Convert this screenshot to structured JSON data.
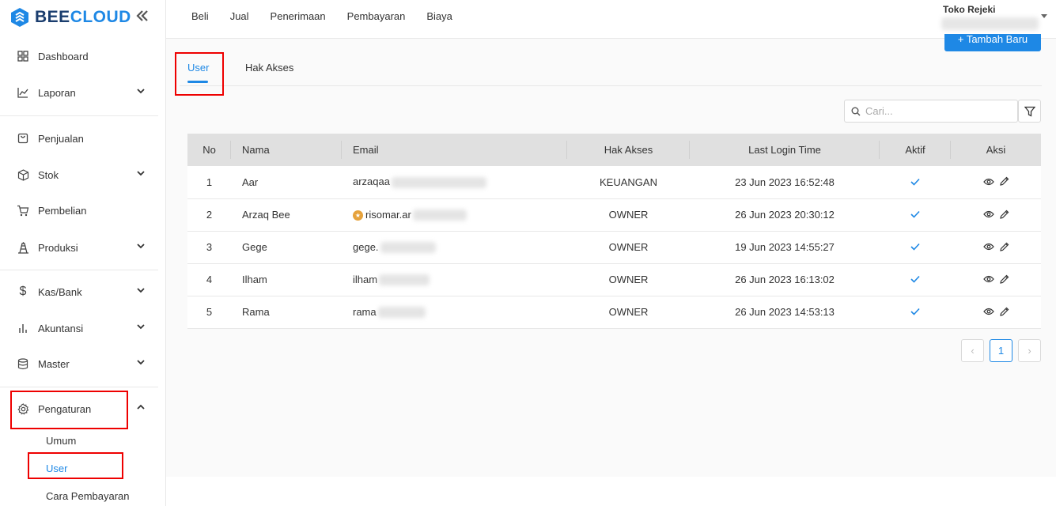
{
  "brand": {
    "part1": "BEE",
    "part2": "CLOUD"
  },
  "sidebar": {
    "items": [
      {
        "label": "Dashboard",
        "icon": "grid-icon"
      },
      {
        "label": "Laporan",
        "icon": "chart-line-icon"
      },
      {
        "label": "Penjualan",
        "icon": "bag-icon"
      },
      {
        "label": "Stok",
        "icon": "box-icon"
      },
      {
        "label": "Pembelian",
        "icon": "cart-icon"
      },
      {
        "label": "Produksi",
        "icon": "factory-icon"
      },
      {
        "label": "Kas/Bank",
        "icon": "dollar-icon"
      },
      {
        "label": "Akuntansi",
        "icon": "bar-chart-icon"
      },
      {
        "label": "Master",
        "icon": "database-icon"
      },
      {
        "label": "Pengaturan",
        "icon": "gear-icon"
      }
    ],
    "sub_items": [
      {
        "label": "Umum"
      },
      {
        "label": "User"
      },
      {
        "label": "Cara Pembayaran"
      }
    ]
  },
  "topnav": [
    "Beli",
    "Jual",
    "Penerimaan",
    "Pembayaran",
    "Biaya"
  ],
  "store": {
    "name": "Toko Rejeki"
  },
  "add_button": {
    "label": "+ Tambah Baru"
  },
  "tabs": [
    "User",
    "Hak Akses"
  ],
  "search": {
    "placeholder": "Cari..."
  },
  "table": {
    "headers": [
      "No",
      "Nama",
      "Email",
      "Hak Akses",
      "Last Login Time",
      "Aktif",
      "Aksi"
    ],
    "rows": [
      {
        "no": "1",
        "nama": "Aar",
        "email": "arzaqaa",
        "hak": "KEUANGAN",
        "login": "23 Jun 2023 16:52:48"
      },
      {
        "no": "2",
        "nama": "Arzaq Bee",
        "email": "risomar.ar",
        "hak": "OWNER",
        "login": "26 Jun 2023 20:30:12"
      },
      {
        "no": "3",
        "nama": "Gege",
        "email": "gege.",
        "hak": "OWNER",
        "login": "19 Jun 2023 14:55:27"
      },
      {
        "no": "4",
        "nama": "Ilham",
        "email": "ilham",
        "hak": "OWNER",
        "login": "26 Jun 2023 16:13:02"
      },
      {
        "no": "5",
        "nama": "Rama",
        "email": "rama",
        "hak": "OWNER",
        "login": "26 Jun 2023 14:53:13"
      }
    ]
  },
  "pagination": {
    "current": "1",
    "prev": "‹",
    "next": "›"
  },
  "colors": {
    "accent": "#1e88e5",
    "highlight": "#e00000",
    "brand_dark": "#1a3d6e"
  }
}
